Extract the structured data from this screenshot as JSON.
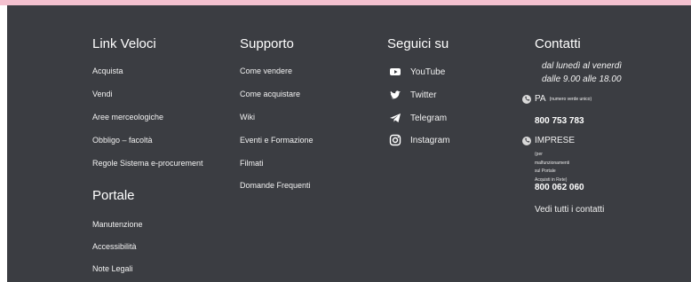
{
  "colors": {
    "footer_bg": "#3b3d42",
    "top_strip": "#f3c1cf",
    "text": "#ffffff"
  },
  "link_veloci": {
    "title": "Link Veloci",
    "items": [
      "Acquista",
      "Vendi",
      "Aree merceologiche",
      "Obbligo – facoltà",
      "Regole Sistema e-procurement"
    ]
  },
  "portale": {
    "title": "Portale",
    "items": [
      "Manutenzione",
      "Accessibilità",
      "Note Legali"
    ]
  },
  "supporto": {
    "title": "Supporto",
    "items": [
      "Come vendere",
      "Come acquistare",
      "Wiki",
      "Eventi e Formazione",
      "Filmati",
      "Domande Frequenti"
    ]
  },
  "seguici": {
    "title": "Seguici su",
    "items": [
      {
        "label": "YouTube",
        "icon": "youtube-icon"
      },
      {
        "label": "Twitter",
        "icon": "twitter-icon"
      },
      {
        "label": "Telegram",
        "icon": "telegram-icon"
      },
      {
        "label": "Instagram",
        "icon": "instagram-icon"
      }
    ]
  },
  "contatti": {
    "title": "Contatti",
    "hours_line1": "dal lunedì al venerdì",
    "hours_line2": "dalle 9.00 alle 18.00",
    "pa_label": "PA",
    "pa_note": "(numero verde unico)",
    "pa_number": "800 753 783",
    "imprese_label": "IMPRESE",
    "imprese_note_line1": "(per malfunzionamenti sul Portale",
    "imprese_note_line2": "Acquisti in Rete)",
    "imprese_number": "800 062 060",
    "all_contacts": "Vedi tutti i contatti"
  }
}
